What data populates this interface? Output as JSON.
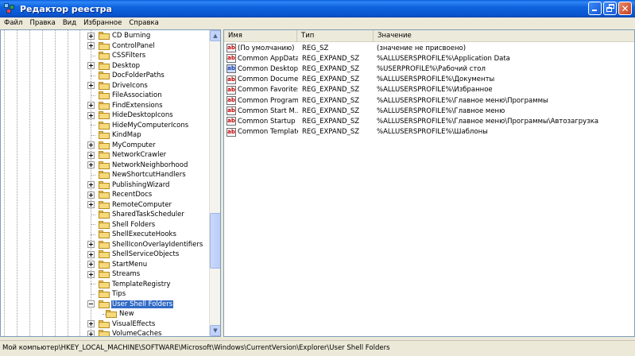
{
  "window": {
    "title": "Редактор реестра"
  },
  "menu": [
    "Файл",
    "Правка",
    "Вид",
    "Избранное",
    "Справка"
  ],
  "tree": {
    "items": [
      {
        "label": "CD Burning",
        "expandable": true
      },
      {
        "label": "ControlPanel",
        "expandable": true
      },
      {
        "label": "CSSFilters",
        "expandable": false
      },
      {
        "label": "Desktop",
        "expandable": true
      },
      {
        "label": "DocFolderPaths",
        "expandable": false
      },
      {
        "label": "DriveIcons",
        "expandable": true
      },
      {
        "label": "FileAssociation",
        "expandable": false
      },
      {
        "label": "FindExtensions",
        "expandable": true
      },
      {
        "label": "HideDesktopIcons",
        "expandable": true
      },
      {
        "label": "HideMyComputerIcons",
        "expandable": false
      },
      {
        "label": "KindMap",
        "expandable": false
      },
      {
        "label": "MyComputer",
        "expandable": true
      },
      {
        "label": "NetworkCrawler",
        "expandable": true
      },
      {
        "label": "NetworkNeighborhood",
        "expandable": true
      },
      {
        "label": "NewShortcutHandlers",
        "expandable": false
      },
      {
        "label": "PublishingWizard",
        "expandable": true
      },
      {
        "label": "RecentDocs",
        "expandable": true
      },
      {
        "label": "RemoteComputer",
        "expandable": true
      },
      {
        "label": "SharedTaskScheduler",
        "expandable": false
      },
      {
        "label": "Shell Folders",
        "expandable": false
      },
      {
        "label": "ShellExecuteHooks",
        "expandable": false
      },
      {
        "label": "ShellIconOverlayIdentifiers",
        "expandable": true
      },
      {
        "label": "ShellServiceObjects",
        "expandable": true
      },
      {
        "label": "StartMenu",
        "expandable": true
      },
      {
        "label": "Streams",
        "expandable": true
      },
      {
        "label": "TemplateRegistry",
        "expandable": false
      },
      {
        "label": "Tips",
        "expandable": false
      },
      {
        "label": "User Shell Folders",
        "expandable": true,
        "expanded": true,
        "selected": true
      },
      {
        "label": "New",
        "expandable": false,
        "child": true
      },
      {
        "label": "VisualEffects",
        "expandable": true
      },
      {
        "label": "VolumeCaches",
        "expandable": true
      }
    ]
  },
  "list": {
    "columns": [
      "Имя",
      "Тип",
      "Значение"
    ],
    "rows": [
      {
        "name": "(По умолчанию)",
        "type": "REG_SZ",
        "data": "(значение не присвоено)",
        "icon": "string-icon"
      },
      {
        "name": "Common AppData",
        "type": "REG_EXPAND_SZ",
        "data": "%ALLUSERSPROFILE%\\Application Data",
        "icon": "string-icon"
      },
      {
        "name": "Common Desktop",
        "type": "REG_EXPAND_SZ",
        "data": "%USERPROFILE%\\Рабочий стол",
        "icon": "string-icon-selected"
      },
      {
        "name": "Common Docume...",
        "type": "REG_EXPAND_SZ",
        "data": "%ALLUSERSPROFILE%\\Документы",
        "icon": "string-icon"
      },
      {
        "name": "Common Favorites",
        "type": "REG_EXPAND_SZ",
        "data": "%ALLUSERSPROFILE%\\Избранное",
        "icon": "string-icon"
      },
      {
        "name": "Common Programs",
        "type": "REG_EXPAND_SZ",
        "data": "%ALLUSERSPROFILE%\\Главное меню\\Программы",
        "icon": "string-icon"
      },
      {
        "name": "Common Start M...",
        "type": "REG_EXPAND_SZ",
        "data": "%ALLUSERSPROFILE%\\Главное меню",
        "icon": "string-icon"
      },
      {
        "name": "Common Startup",
        "type": "REG_EXPAND_SZ",
        "data": "%ALLUSERSPROFILE%\\Главное меню\\Программы\\Автозагрузка",
        "icon": "string-icon"
      },
      {
        "name": "Common Templates",
        "type": "REG_EXPAND_SZ",
        "data": "%ALLUSERSPROFILE%\\Шаблоны",
        "icon": "string-icon"
      }
    ]
  },
  "status": {
    "path": "Мой компьютер\\HKEY_LOCAL_MACHINE\\SOFTWARE\\Microsoft\\Windows\\CurrentVersion\\Explorer\\User Shell Folders"
  }
}
